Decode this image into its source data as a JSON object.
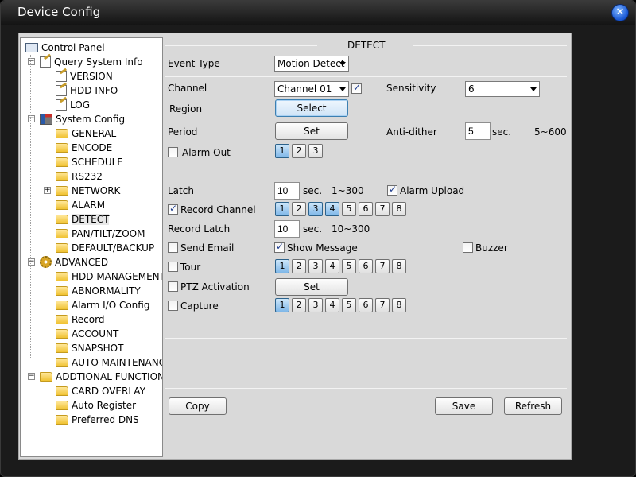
{
  "window": {
    "title": "Device Config"
  },
  "tree": [
    {
      "label": "Control Panel",
      "icon": "computer-icon",
      "level": 0
    },
    {
      "label": "Query System Info",
      "icon": "edit-icon",
      "level": 1,
      "expander": "−"
    },
    {
      "label": "VERSION",
      "icon": "edit-icon",
      "level": 2
    },
    {
      "label": "HDD INFO",
      "icon": "edit-icon",
      "level": 2
    },
    {
      "label": "LOG",
      "icon": "edit-icon",
      "level": 2
    },
    {
      "label": "System Config",
      "icon": "tools-icon",
      "level": 1,
      "expander": "−"
    },
    {
      "label": "GENERAL",
      "icon": "folder-icon",
      "level": 2
    },
    {
      "label": "ENCODE",
      "icon": "folder-icon",
      "level": 2
    },
    {
      "label": "SCHEDULE",
      "icon": "folder-icon",
      "level": 2
    },
    {
      "label": "RS232",
      "icon": "folder-icon",
      "level": 2
    },
    {
      "label": "NETWORK",
      "icon": "folder-icon",
      "level": 2,
      "expander": "+"
    },
    {
      "label": "ALARM",
      "icon": "folder-icon",
      "level": 2
    },
    {
      "label": "DETECT",
      "icon": "folder-icon",
      "level": 2,
      "selected": true
    },
    {
      "label": "PAN/TILT/ZOOM",
      "icon": "folder-icon",
      "level": 2
    },
    {
      "label": "DEFAULT/BACKUP",
      "icon": "folder-icon",
      "level": 2
    },
    {
      "label": "ADVANCED",
      "icon": "gear-icon",
      "level": 1,
      "expander": "−"
    },
    {
      "label": "HDD MANAGEMENT",
      "icon": "folder-icon",
      "level": 2
    },
    {
      "label": "ABNORMALITY",
      "icon": "folder-icon",
      "level": 2
    },
    {
      "label": "Alarm I/O Config",
      "icon": "folder-icon",
      "level": 2
    },
    {
      "label": "Record",
      "icon": "folder-icon",
      "level": 2
    },
    {
      "label": "ACCOUNT",
      "icon": "folder-icon",
      "level": 2
    },
    {
      "label": "SNAPSHOT",
      "icon": "folder-icon",
      "level": 2
    },
    {
      "label": "AUTO MAINTENANC",
      "icon": "folder-icon",
      "level": 2
    },
    {
      "label": "ADDTIONAL FUNCTION",
      "icon": "folder-icon",
      "level": 1,
      "expander": "−"
    },
    {
      "label": "CARD OVERLAY",
      "icon": "folder-icon",
      "level": 2
    },
    {
      "label": "Auto Register",
      "icon": "folder-icon",
      "level": 2
    },
    {
      "label": "Preferred DNS",
      "icon": "folder-icon",
      "level": 2
    }
  ],
  "detect": {
    "section_title": "DETECT",
    "event_type": {
      "label": "Event Type",
      "value": "Motion Detect"
    },
    "channel": {
      "label": "Channel",
      "value": "Channel 01",
      "enabled": true
    },
    "sensitivity": {
      "label": "Sensitivity",
      "value": "6"
    },
    "region": {
      "label": "Region",
      "button": "Select"
    },
    "period": {
      "label": "Period",
      "button": "Set"
    },
    "anti_dither": {
      "label": "Anti-dither",
      "value": "5",
      "unit": "sec.",
      "range": "5~600"
    },
    "alarm_out": {
      "label": "Alarm Out",
      "checked": false,
      "channels": [
        "1",
        "2",
        "3"
      ],
      "active": [
        0
      ]
    },
    "latch": {
      "label": "Latch",
      "value": "10",
      "unit": "sec.",
      "range": "1~300"
    },
    "alarm_upload": {
      "label": "Alarm Upload",
      "checked": true
    },
    "record_channel": {
      "label": "Record Channel",
      "checked": true,
      "channels": [
        "1",
        "2",
        "3",
        "4",
        "5",
        "6",
        "7",
        "8"
      ],
      "active": [
        0,
        2,
        3
      ]
    },
    "record_latch": {
      "label": "Record Latch",
      "value": "10",
      "unit": "sec.",
      "range": "10~300"
    },
    "send_email": {
      "label": "Send Email",
      "checked": false
    },
    "show_message": {
      "label": "Show Message",
      "checked": true
    },
    "buzzer": {
      "label": "Buzzer",
      "checked": false
    },
    "tour": {
      "label": "Tour",
      "checked": false,
      "channels": [
        "1",
        "2",
        "3",
        "4",
        "5",
        "6",
        "7",
        "8"
      ],
      "active": [
        0
      ]
    },
    "ptz": {
      "label": "PTZ Activation",
      "checked": false,
      "button": "Set"
    },
    "capture": {
      "label": "Capture",
      "checked": false,
      "channels": [
        "1",
        "2",
        "3",
        "4",
        "5",
        "6",
        "7",
        "8"
      ],
      "active": [
        0
      ]
    }
  },
  "footer": {
    "copy": "Copy",
    "save": "Save",
    "refresh": "Refresh"
  }
}
